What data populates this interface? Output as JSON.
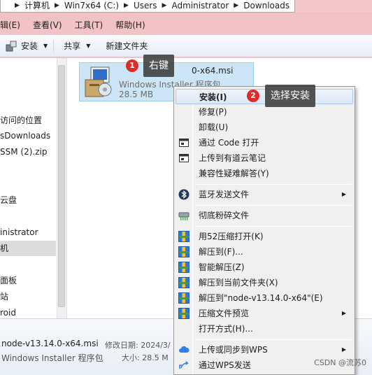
{
  "address_bar": {
    "crumbs": [
      "计算机",
      "Win7x64 (C:)",
      "Users",
      "Administrator",
      "Downloads"
    ]
  },
  "menu_bar": {
    "items": [
      "编辑(E)",
      "查看(V)",
      "工具(T)",
      "帮助(H)"
    ]
  },
  "toolbar": {
    "install": "安装",
    "share": "共享",
    "new_folder": "新建文件夹"
  },
  "nav": {
    "items": [
      "访问的位置",
      "sDownloads",
      "SSM (2).zip",
      "云盘",
      "inistrator",
      "机",
      "面板",
      "站",
      "roid"
    ]
  },
  "file": {
    "name": "node-v13.14.0-x64.msi",
    "name_visible_fragment": "0-x64.msi",
    "type": "Windows Installer 程序包",
    "size": "28.5 MB"
  },
  "annotations": {
    "step1_number": "1",
    "step1_label": "右键",
    "step2_number": "2",
    "step2_label": "选择安装"
  },
  "context_menu": {
    "items": [
      {
        "label": "安装(I)"
      },
      {
        "label": "修复(P)"
      },
      {
        "label": "卸载(U)"
      },
      {
        "label": "通过 Code 打开"
      },
      {
        "label": "上传到有道云笔记"
      },
      {
        "label": "兼容性疑难解答(Y)"
      },
      {
        "label": "蓝牙发送文件"
      },
      {
        "label": "彻底粉碎文件"
      },
      {
        "label": "用52压缩打开(K)"
      },
      {
        "label": "解压到(F)..."
      },
      {
        "label": "智能解压(Z)"
      },
      {
        "label": "解压到当前文件夹(X)"
      },
      {
        "label": "解压到\"node-v13.14.0-x64\"(E)"
      },
      {
        "label": "压缩文件预览"
      },
      {
        "label": "打开方式(H)..."
      },
      {
        "label": "上传或同步到WPS"
      },
      {
        "label": "通过WPS发送"
      }
    ]
  },
  "status_bar": {
    "file_name": "node-v13.14.0-x64.msi",
    "modified_label": "修改日期: 2024/3/",
    "file_type": "Windows Installer 程序包",
    "size_label": "大小: 28.5 M"
  },
  "watermark": "CSDN @流苏0"
}
